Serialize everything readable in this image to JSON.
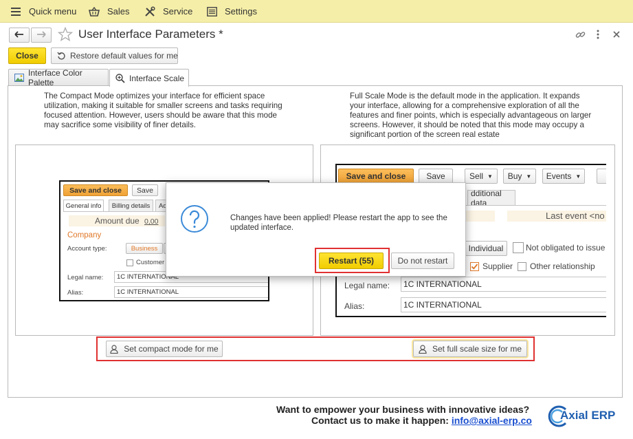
{
  "topbar": {
    "items": [
      {
        "label": "Quick menu",
        "icon": "hamburger-icon"
      },
      {
        "label": "Sales",
        "icon": "basket-icon"
      },
      {
        "label": "Service",
        "icon": "tools-icon"
      },
      {
        "label": "Settings",
        "icon": "settings-list-icon"
      }
    ]
  },
  "header": {
    "title": "User Interface Parameters *"
  },
  "toolbar": {
    "close_label": "Close",
    "restore_label": "Restore default values for me"
  },
  "tabs": [
    {
      "label": "Interface Color Palette",
      "active": false
    },
    {
      "label": "Interface Scale",
      "active": true
    }
  ],
  "compact": {
    "description": "The Compact Mode optimizes your interface for efficient space utilization, making it suitable for smaller screens and tasks requiring focused attention. However, users should be aware that this mode may sacrifice some visibility of finer details.",
    "set_button": "Set compact mode for me"
  },
  "full": {
    "description": "Full Scale Mode is the default mode in the application. It expands your interface, allowing for a comprehensive exploration of all the features and finer points, which is especially advantageous on larger screens. However, it should be noted that this mode may occupy a significant portion of the screen real estate",
    "set_button": "Set full scale size for me"
  },
  "preview_compact": {
    "save_close": "Save and close",
    "save": "Save",
    "tab_general": "General info",
    "tab_billing": "Billing details",
    "tab_partial": "Ad",
    "amount_due": "Amount due",
    "amount_value": "0,00",
    "company": "Company",
    "account_type": "Account type:",
    "business": "Business",
    "customer": "Customer",
    "legal_name_label": "Legal name:",
    "legal_name_value": "1C INTERNATIONAL",
    "alias_label": "Alias:",
    "alias_value": "1C INTERNATIONAL"
  },
  "preview_full": {
    "save_close": "Save and close",
    "save": "Save",
    "sell": "Sell",
    "buy": "Buy",
    "events": "Events",
    "additional_data": "dditional data",
    "last_event": "Last event <no",
    "individual": "Individual",
    "not_obligated": "Not obligated to issue",
    "supplier": "Supplier",
    "other_relationship": "Other relationship",
    "legal_name_label": "Legal name:",
    "legal_name_value": "1C INTERNATIONAL",
    "alias_label": "Alias:",
    "alias_value": "1C INTERNATIONAL"
  },
  "dialog": {
    "message": "Changes have been applied! Please restart the app to see the updated interface.",
    "restart_label": "Restart (55)",
    "no_restart_label": "Do not restart"
  },
  "footer": {
    "line1": "Want to empower your business with innovative ideas?",
    "line2": "Contact us to make it happen:",
    "email": "info@axial-erp.co",
    "logo_text": "Axial ERP"
  },
  "colors": {
    "topbar_bg": "#f5eea8",
    "primary_yellow": "#f5d800",
    "orange": "#f3a83c",
    "highlight_red": "#e03030",
    "link_blue": "#1a4fd0",
    "logo_blue": "#1f5fb0"
  }
}
